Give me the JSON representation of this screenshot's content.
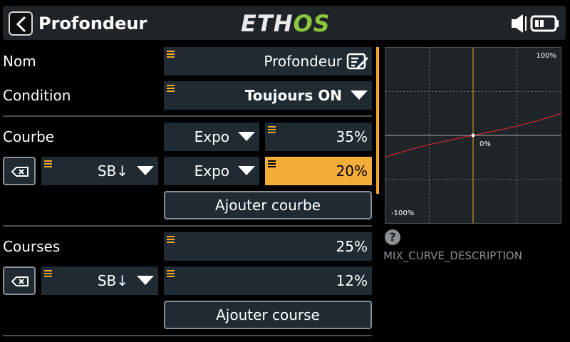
{
  "header": {
    "title": "Profondeur",
    "logo_part1": "ETH",
    "logo_part2": "OS"
  },
  "rows": {
    "name": {
      "label": "Nom",
      "value": "Profondeur"
    },
    "condition": {
      "label": "Condition",
      "value": "Toujours ON"
    },
    "curve": {
      "label": "Courbe",
      "type": "Expo",
      "value": "35%",
      "switch": "SB↓",
      "switch_type": "Expo",
      "switch_value": "20%",
      "add_label": "Ajouter courbe"
    },
    "rates": {
      "label": "Courses",
      "value": "25%",
      "switch": "SB↓",
      "switch_value": "12%",
      "add_label": "Ajouter course"
    }
  },
  "graph": {
    "top_right_label": "100%",
    "center_label": "0%",
    "bottom_left_label": "-100%"
  },
  "help": {
    "icon": "question-icon",
    "glyph": "?",
    "description": "MIX_CURVE_DESCRIPTION"
  },
  "colors": {
    "accent": "#f5a623",
    "logo_green": "#8dc63f",
    "curve": "#d62a2a",
    "field_bg": "#1f2a33"
  },
  "chart_data": {
    "type": "line",
    "x_range": [
      -100,
      100
    ],
    "y_range": [
      -100,
      100
    ],
    "expo_percent": 20,
    "series": [
      {
        "values": [
          [
            -100,
            -25
          ],
          [
            -50,
            -10
          ],
          [
            0,
            0
          ],
          [
            50,
            10
          ],
          [
            100,
            25
          ]
        ]
      }
    ],
    "grid": true,
    "cursor_x": 0
  }
}
